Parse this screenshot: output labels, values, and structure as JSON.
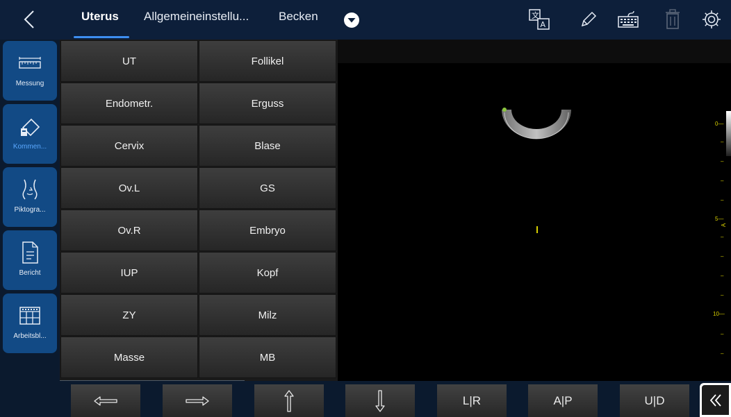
{
  "header": {
    "back_icon": "chevron-left-icon",
    "tabs": [
      "Uterus",
      "Allgemeineinstellu...",
      "Becken"
    ],
    "dropdown_icon": "chevron-down-circle-icon",
    "tool_icons": [
      "translate-icon",
      "pencil-icon",
      "keyboard-icon",
      "trash-icon",
      "settings-icon"
    ]
  },
  "sidebar": {
    "items": [
      {
        "label": "Messung",
        "icon": "ruler-icon"
      },
      {
        "label": "Kommen...",
        "icon": "comment-icon",
        "active": true
      },
      {
        "label": "Piktogra...",
        "icon": "pictogram-icon"
      },
      {
        "label": "Bericht",
        "icon": "report-icon"
      },
      {
        "label": "Arbeitsbl...",
        "icon": "worksheet-icon"
      }
    ]
  },
  "annotations": {
    "left_column": [
      "UT",
      "Endometr.",
      "Cervix",
      "Ov.L",
      "Ov.R",
      "IUP",
      "ZY",
      "Masse"
    ],
    "right_column": [
      "Follikel",
      "Erguss",
      "Blase",
      "GS",
      "Embryo",
      "Kopf",
      "Milz",
      "MB"
    ]
  },
  "bottom_bar": {
    "arrow_icons": [
      "arrow-left-icon",
      "arrow-right-icon",
      "arrow-up-icon",
      "arrow-down-icon"
    ],
    "flip_buttons": [
      "L|R",
      "A|P",
      "U|D"
    ],
    "collapse_icon": "double-chevron-left-icon"
  },
  "depth_scale": {
    "labels": [
      "0",
      "5",
      "10"
    ],
    "marker": "A"
  },
  "colors": {
    "accent": "#3d8ef0",
    "sidebar_active": "#124a85",
    "scale": "#d8d000"
  }
}
